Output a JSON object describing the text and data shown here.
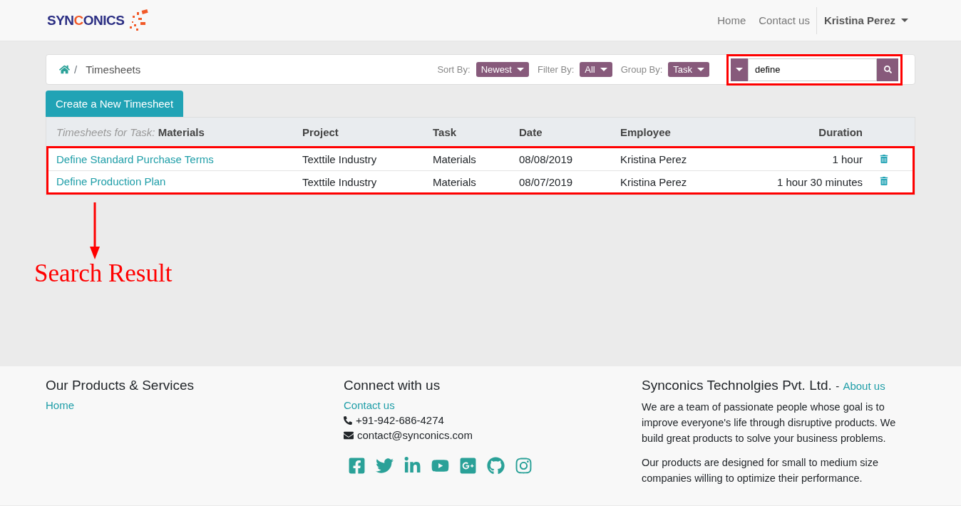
{
  "navbar": {
    "logo": {
      "prefix": "SYN",
      "accent": "C",
      "suffix": "ONICS"
    },
    "links": [
      "Home",
      "Contact us"
    ],
    "user": "Kristina Perez"
  },
  "breadcrumb": {
    "separator": "/",
    "current": "Timesheets"
  },
  "controls": [
    {
      "label": "Sort By:",
      "value": "Newest"
    },
    {
      "label": "Filter By:",
      "value": "All"
    },
    {
      "label": "Group By:",
      "value": "Task"
    }
  ],
  "search": {
    "value": "define"
  },
  "create_button": "Create a New Timesheet",
  "table": {
    "group_label": "Timesheets for Task:",
    "group_value": "Materials",
    "columns": [
      "Project",
      "Task",
      "Date",
      "Employee",
      "Duration"
    ],
    "rows": [
      {
        "name": "Define Standard Purchase Terms",
        "project": "Texttile Industry",
        "task": "Materials",
        "date": "08/08/2019",
        "employee": "Kristina Perez",
        "duration": "1 hour"
      },
      {
        "name": "Define Production Plan",
        "project": "Texttile Industry",
        "task": "Materials",
        "date": "08/07/2019",
        "employee": "Kristina Perez",
        "duration": "1 hour 30 minutes"
      }
    ]
  },
  "annotation": "Search Result",
  "footer": {
    "products": {
      "title": "Our Products & Services",
      "links": [
        "Home"
      ]
    },
    "connect": {
      "title": "Connect with us",
      "link": "Contact us",
      "phone": "+91-942-686-4274",
      "email": "contact@synconics.com"
    },
    "company": {
      "title": "Synconics Technolgies Pvt. Ltd.",
      "separator": "-",
      "link": "About us",
      "paragraphs": [
        "We are a team of passionate people whose goal is to improve everyone's life through disruptive products. We build great products to solve your business problems.",
        "Our products are designed for small to medium size companies willing to optimize their performance."
      ]
    }
  }
}
